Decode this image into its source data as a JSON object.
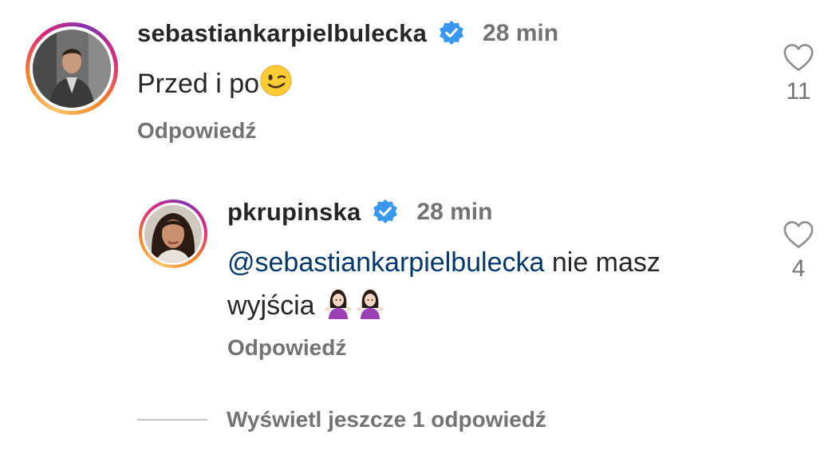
{
  "comments": [
    {
      "username": "sebastiankarpielbulecka",
      "time": "28 min",
      "text": "Przed i po",
      "reply_label": "Odpowiedź",
      "likes": "11",
      "verified": true,
      "emoji": "wink-emoji"
    },
    {
      "username": "pkrupinska",
      "time": "28 min",
      "mention": "@sebastiankarpielbulecka",
      "text_line1_rest": " nie masz",
      "text_line2": "wyjścia",
      "reply_label": "Odpowiedź",
      "likes": "4",
      "verified": true,
      "emoji": "woman-shrugging-emoji"
    }
  ],
  "view_more_label": "Wyświetl jeszcze 1 odpowiedź",
  "colors": {
    "verified_blue": "#3897f0",
    "mention_blue": "#00376b",
    "secondary_text": "#737373",
    "primary_text": "#262626"
  }
}
